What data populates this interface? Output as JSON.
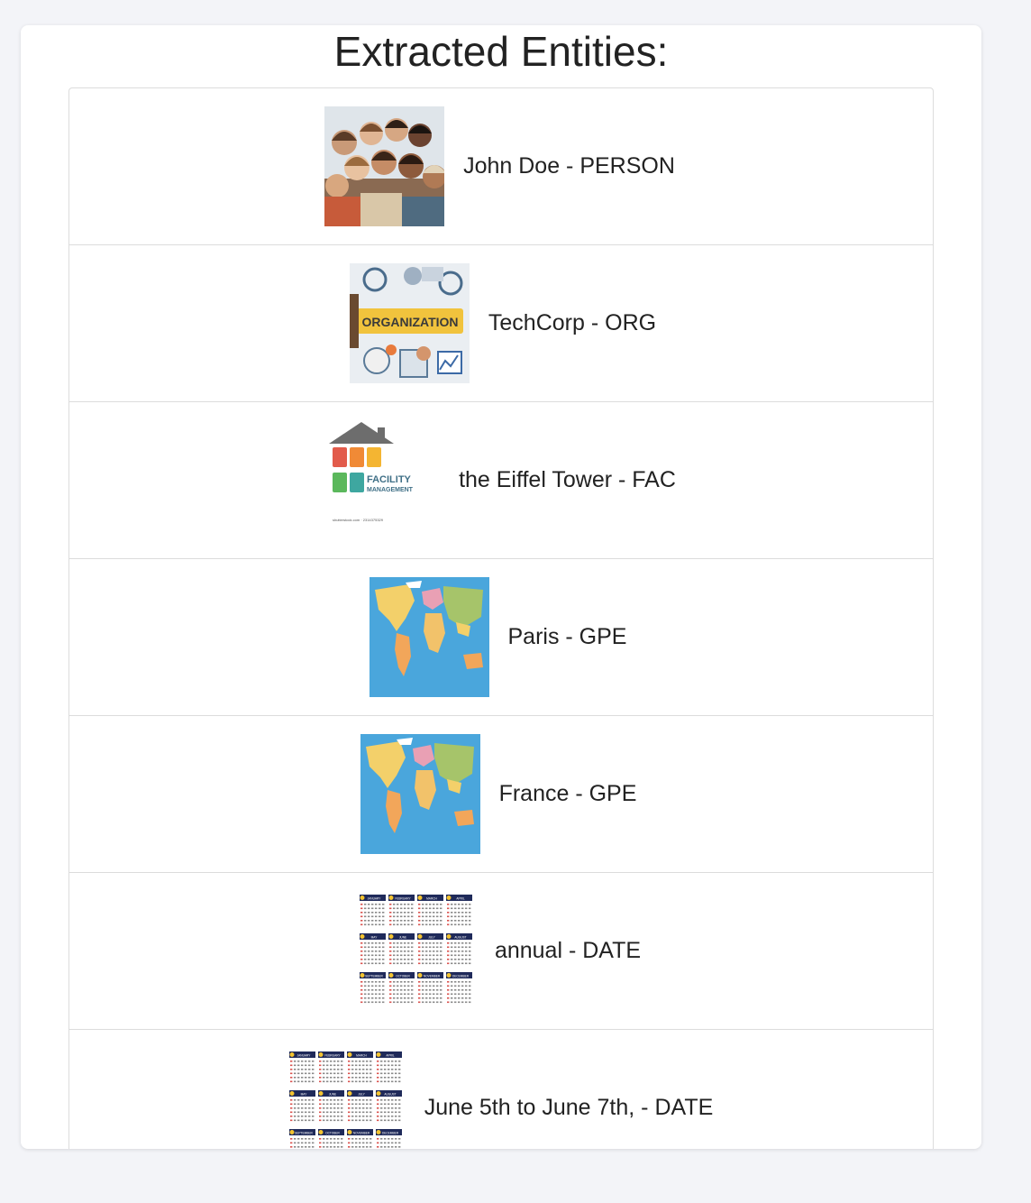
{
  "title": "Extracted Entities:",
  "entities": [
    {
      "text": "John Doe - PERSON",
      "icon": "people-photo-icon"
    },
    {
      "text": "TechCorp - ORG",
      "icon": "organization-image-icon"
    },
    {
      "text": "the Eiffel Tower - FAC",
      "icon": "facility-management-icon"
    },
    {
      "text": "Paris - GPE",
      "icon": "world-map-icon"
    },
    {
      "text": "France - GPE",
      "icon": "world-map-icon"
    },
    {
      "text": "annual - DATE",
      "icon": "calendar-icon"
    },
    {
      "text": "June 5th to June 7th, - DATE",
      "icon": "calendar-icon"
    }
  ],
  "thumb_text": {
    "org_banner": "ORGANIZATION",
    "facility_line1": "FACILITY",
    "facility_line2": "MANAGEMENT",
    "facility_credit": "shutterstock.com · 2314375329",
    "months": [
      "JANUARY",
      "FEBRUARY",
      "MARCH",
      "APRIL",
      "MAY",
      "JUNE",
      "JULY",
      "AUGUST",
      "SEPTEMBER",
      "OCTOBER",
      "NOVEMBER",
      "DECEMBER"
    ]
  },
  "colors": {
    "background": "#f3f4f8",
    "card": "#ffffff",
    "border": "#dcdcdc",
    "text": "#222222",
    "map_ocean": "#4aa6dc",
    "calendar_header": "#1f2a5a"
  }
}
